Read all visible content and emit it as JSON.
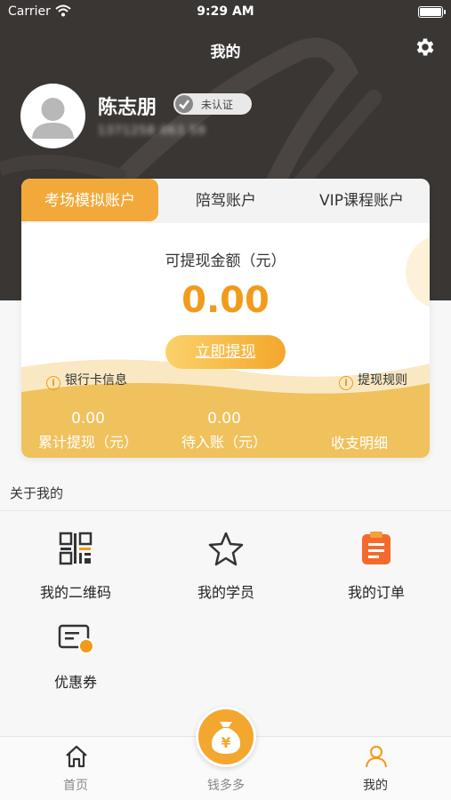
{
  "status_bar": {
    "carrier": "Carrier",
    "time": "9:29 AM"
  },
  "header": {
    "title": "我的",
    "username": "陈志朋",
    "cert_status": "未认证",
    "user_id_masked": "1371258 063 59"
  },
  "account_card": {
    "tabs": [
      {
        "label": "考场模拟账户",
        "active": true
      },
      {
        "label": "陪驾账户",
        "active": false
      },
      {
        "label": "VIP课程账户",
        "active": false
      }
    ],
    "balance_label": "可提现金额（元）",
    "balance": "0.00",
    "withdraw_button": "立即提现",
    "bank_card_info": "银行卡信息",
    "withdraw_rules": "提现规则",
    "stats": [
      {
        "value": "0.00",
        "label": "累计提现（元）"
      },
      {
        "value": "0.00",
        "label": "待入账（元）"
      }
    ],
    "transactions_link": "收支明细"
  },
  "about": {
    "title": "关于我的",
    "items": [
      {
        "label": "我的二维码",
        "icon": "qrcode-icon"
      },
      {
        "label": "我的学员",
        "icon": "star-icon"
      },
      {
        "label": "我的订单",
        "icon": "clipboard-icon"
      },
      {
        "label": "优惠券",
        "icon": "coupon-icon"
      }
    ]
  },
  "tab_bar": {
    "items": [
      {
        "label": "首页",
        "icon": "home-icon",
        "active": false
      },
      {
        "label": "钱多多",
        "icon": "money-bag-icon",
        "active": false
      },
      {
        "label": "我的",
        "icon": "person-icon",
        "active": true
      }
    ]
  },
  "colors": {
    "accent": "#f29a1a",
    "header_bg": "#3a3634",
    "card_wave": "#f0c25d"
  }
}
